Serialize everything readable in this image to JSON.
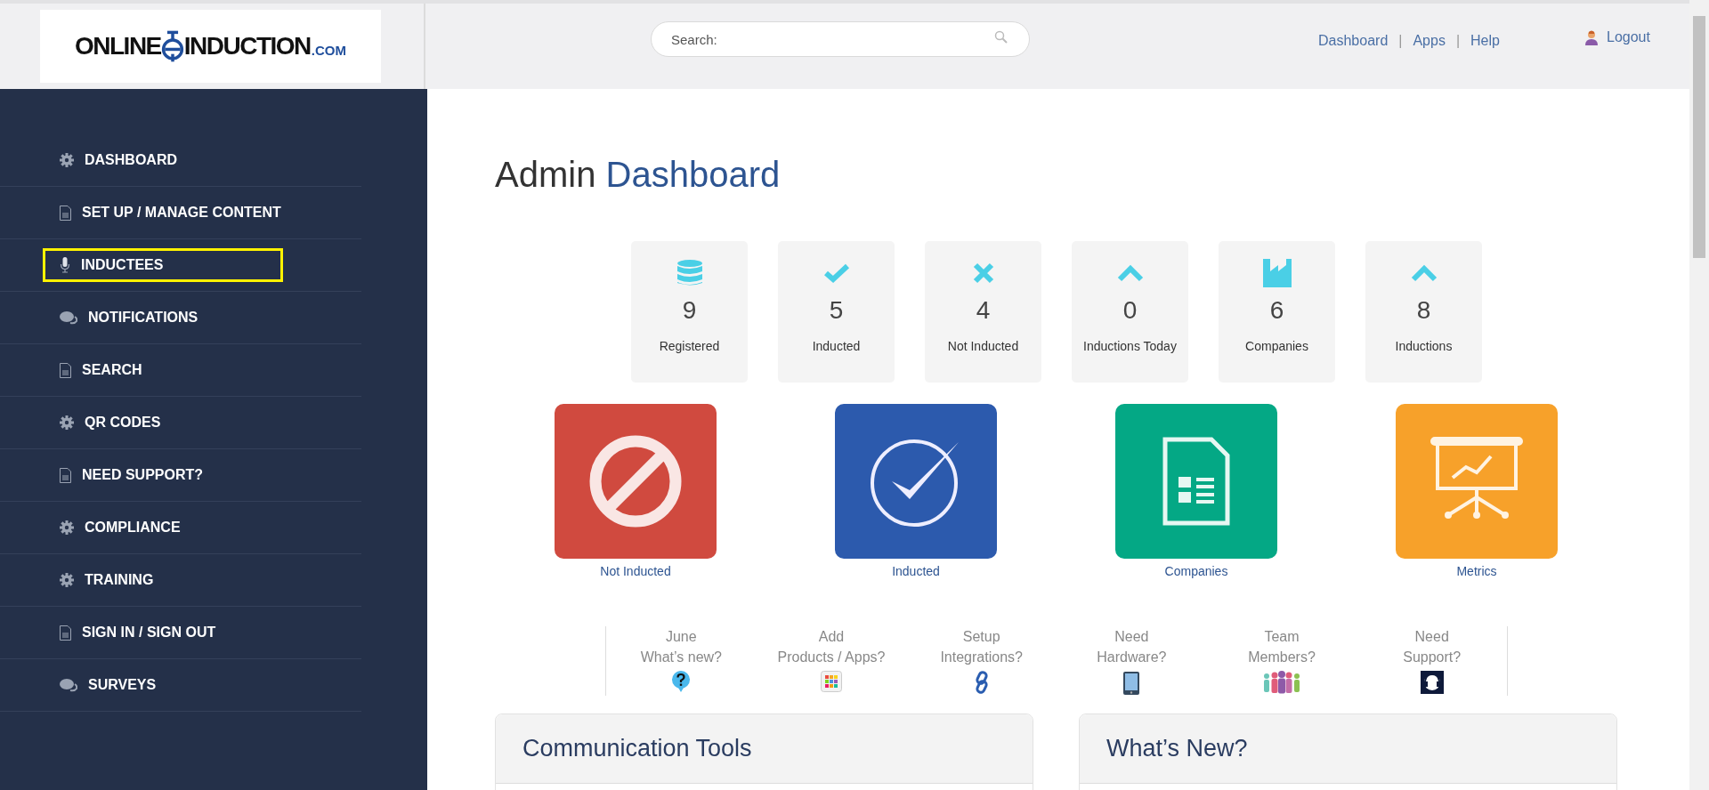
{
  "logo": {
    "word_1": "ONLINE",
    "word_2": "INDUCTION",
    "suffix": ".COM"
  },
  "search": {
    "placeholder": "Search:"
  },
  "top_nav": [
    "Dashboard",
    "Apps",
    "Help"
  ],
  "top_nav_separator": "|",
  "logout": "Logout",
  "sidebar": {
    "items": [
      {
        "label": "DASHBOARD",
        "kind": "gear",
        "highlighted": false
      },
      {
        "label": "SET UP / MANAGE CONTENT",
        "kind": "doc",
        "highlighted": false
      },
      {
        "label": "INDUCTEES",
        "kind": "mic",
        "highlighted": true
      },
      {
        "label": "NOTIFICATIONS",
        "kind": "chat",
        "highlighted": false
      },
      {
        "label": "SEARCH",
        "kind": "doc",
        "highlighted": false
      },
      {
        "label": "QR CODES",
        "kind": "gear",
        "highlighted": false
      },
      {
        "label": "NEED SUPPORT?",
        "kind": "doc",
        "highlighted": false
      },
      {
        "label": "COMPLIANCE",
        "kind": "gear",
        "highlighted": false
      },
      {
        "label": "TRAINING",
        "kind": "gear",
        "highlighted": false
      },
      {
        "label": "SIGN IN / SIGN OUT",
        "kind": "doc",
        "highlighted": false
      },
      {
        "label": "SURVEYS",
        "kind": "chat",
        "highlighted": false
      }
    ]
  },
  "heading": {
    "part_1": "Admin",
    "part_2": "Dashboard"
  },
  "stats": [
    {
      "kind": "database",
      "value": "9",
      "label": "Registered"
    },
    {
      "kind": "check",
      "value": "5",
      "label": "Inducted"
    },
    {
      "kind": "cross",
      "value": "4",
      "label": "Not Inducted"
    },
    {
      "kind": "caret",
      "value": "0",
      "label": "Inductions Today"
    },
    {
      "kind": "factory",
      "value": "6",
      "label": "Companies"
    },
    {
      "kind": "caret",
      "value": "8",
      "label": "Inductions"
    }
  ],
  "tiles": [
    {
      "kind": "ban",
      "color": "#d04a3f",
      "label": "Not Inducted"
    },
    {
      "kind": "check",
      "color": "#2c5aad",
      "label": "Inducted"
    },
    {
      "kind": "form",
      "color": "#04a885",
      "label": "Companies"
    },
    {
      "kind": "presentation",
      "color": "#f7a12a",
      "label": "Metrics"
    }
  ],
  "help_links": [
    {
      "kind": "question",
      "line_1": "June",
      "line_2": "What’s new?"
    },
    {
      "kind": "apps",
      "line_1": "Add",
      "line_2": "Products / Apps?"
    },
    {
      "kind": "link",
      "line_1": "Setup",
      "line_2": "Integrations?"
    },
    {
      "kind": "tablet",
      "line_1": "Need",
      "line_2": "Hardware?"
    },
    {
      "kind": "team",
      "line_1": "Team",
      "line_2": "Members?"
    },
    {
      "kind": "headset",
      "line_1": "Need",
      "line_2": "Support?"
    }
  ],
  "panels": [
    {
      "title": "Communication Tools"
    },
    {
      "title": "What’s New?"
    }
  ]
}
